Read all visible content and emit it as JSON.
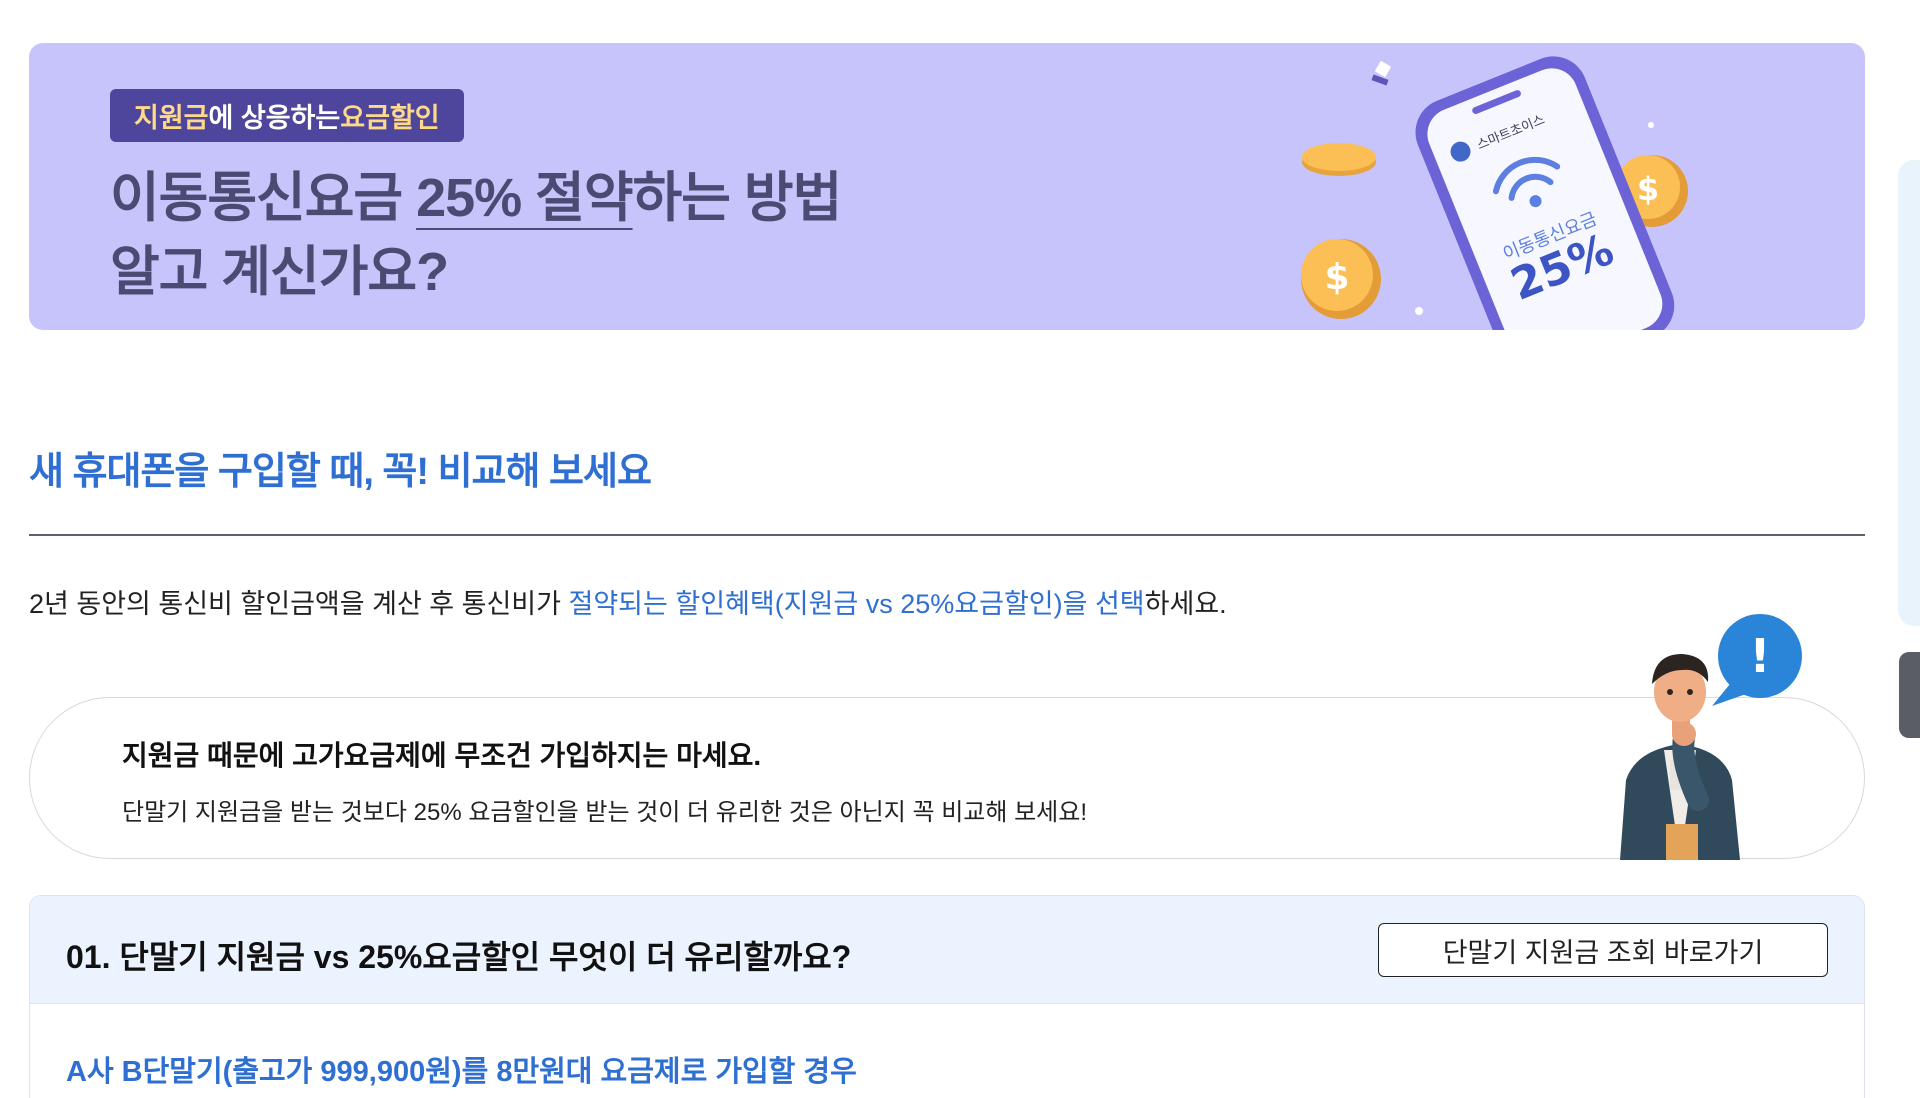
{
  "banner": {
    "tag_part1": "지원금",
    "tag_part2": "에 상응하는 ",
    "tag_part3": "요금할인",
    "title_line1_prefix": "이동통신요금 ",
    "title_line1_underlined": "25% 절약",
    "title_line1_suffix": "하는 방법",
    "title_line2": "알고 계신가요?",
    "phone_brand": "스마트초이스",
    "phone_label": "이동통신요금",
    "phone_value": "25%"
  },
  "section": {
    "title": "새 휴대폰을 구입할 때, 꼭! 비교해 보세요",
    "intro_prefix": "2년 동안의 통신비 할인금액을 계산 후 통신비가 ",
    "intro_highlight": "절약되는 할인혜택(지원금 vs 25%요금할인)을 선택",
    "intro_suffix": "하세요."
  },
  "notice": {
    "title": "지원금 때문에 고가요금제에 무조건 가입하지는 마세요.",
    "description": "단말기 지원금을 받는 것보다 25% 요금할인을 받는 것이 더 유리한 것은 아닌지 꼭 비교해 보세요!",
    "bubble": "!"
  },
  "card": {
    "title": "01. 단말기 지원금 vs 25%요금할인 무엇이 더 유리할까요?",
    "button_label": "단말기 지원금 조회 바로가기",
    "case_title": "A사 B단말기(출고가 999,900원)를 8만원대 요금제로 가입할 경우"
  },
  "colors": {
    "banner_bg": "#c7c4fb",
    "accent_blue": "#2f6fd1",
    "tag_bg": "#4d469c",
    "card_head_bg": "#ebf3ff"
  }
}
